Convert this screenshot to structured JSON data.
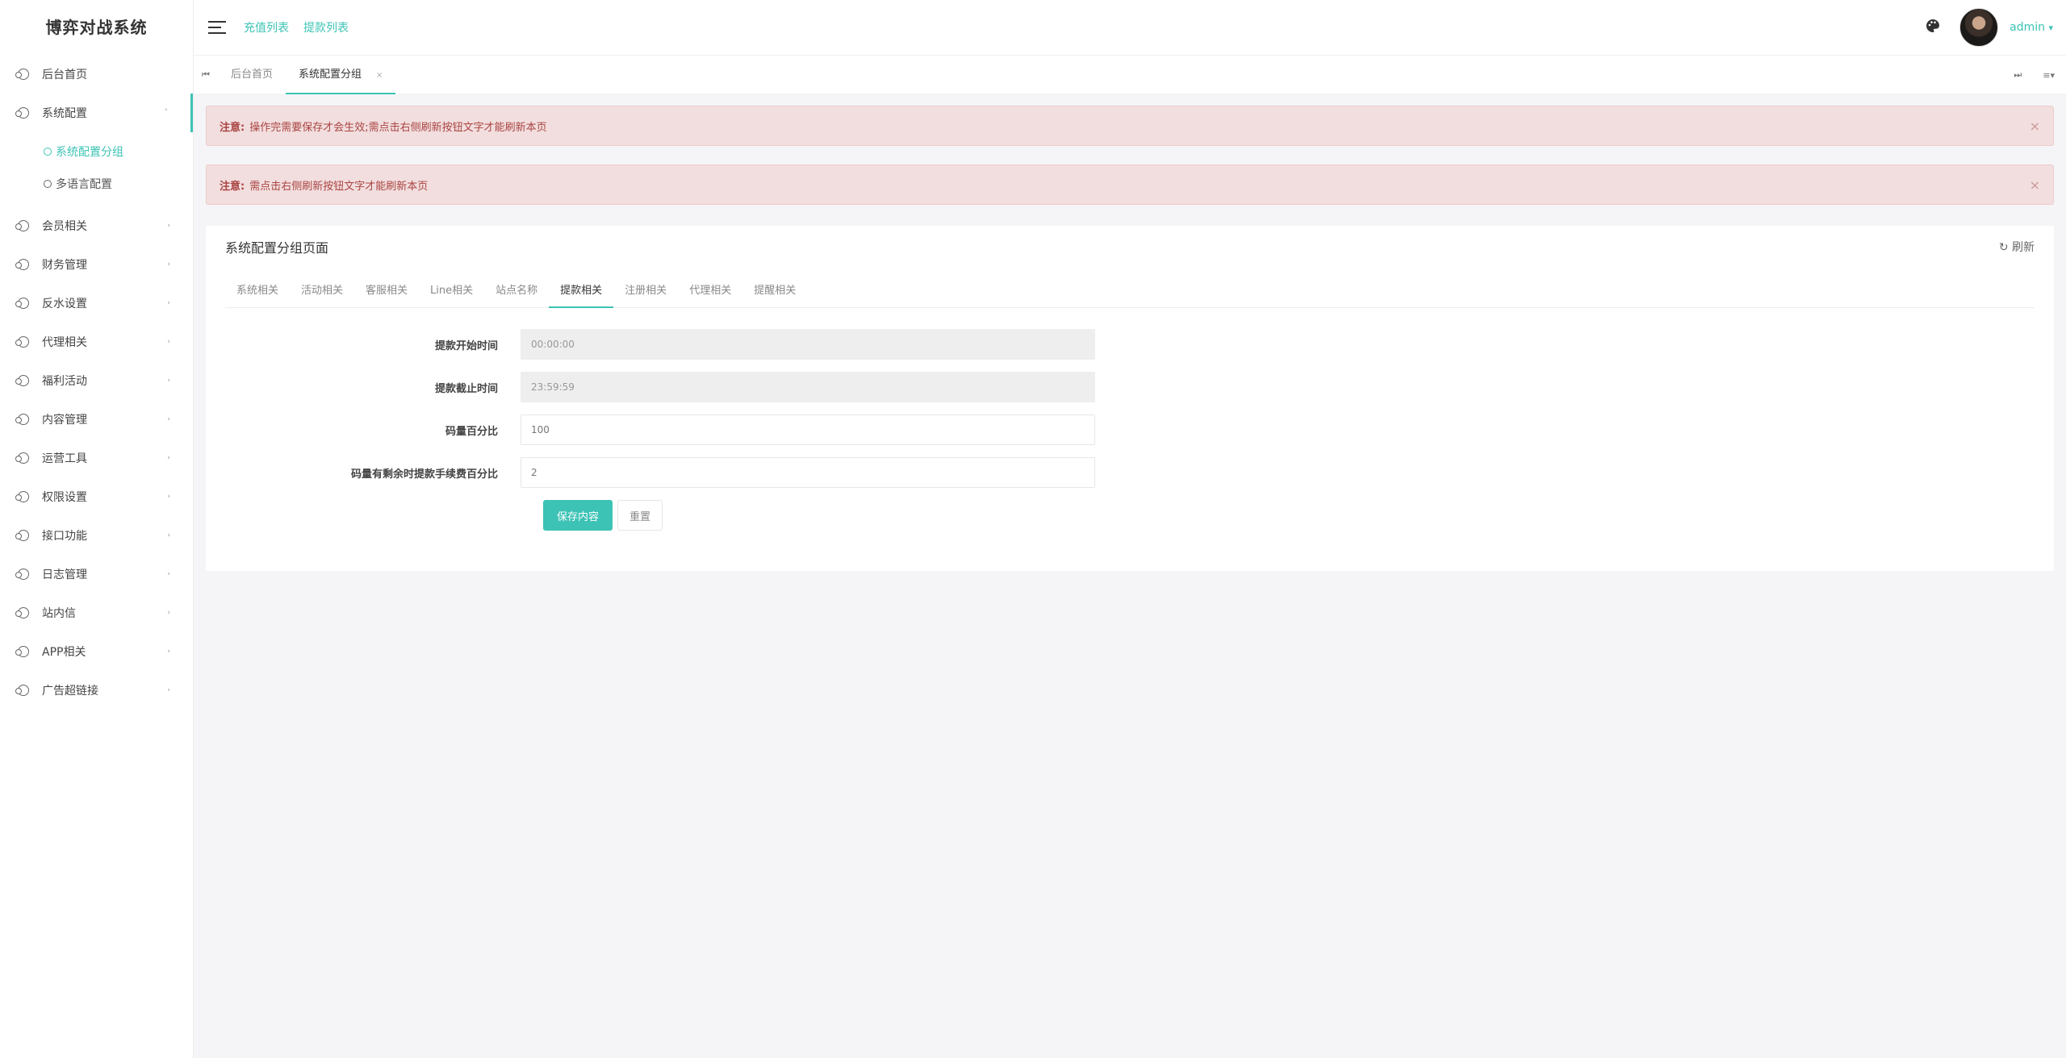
{
  "app": {
    "title": "博弈对战系统"
  },
  "sidebar": {
    "items": [
      {
        "label": "后台首页"
      },
      {
        "label": "系统配置",
        "arrow": "˅",
        "open": true
      },
      {
        "label": "会员相关",
        "arrow": "›"
      },
      {
        "label": "财务管理",
        "arrow": "›"
      },
      {
        "label": "反水设置",
        "arrow": "›"
      },
      {
        "label": "代理相关",
        "arrow": "›"
      },
      {
        "label": "福利活动",
        "arrow": "›"
      },
      {
        "label": "内容管理",
        "arrow": "›"
      },
      {
        "label": "运营工具",
        "arrow": "›"
      },
      {
        "label": "权限设置",
        "arrow": "›"
      },
      {
        "label": "接口功能",
        "arrow": "›"
      },
      {
        "label": "日志管理",
        "arrow": "›"
      },
      {
        "label": "站内信",
        "arrow": "›"
      },
      {
        "label": "APP相关",
        "arrow": "›"
      },
      {
        "label": "广告超链接",
        "arrow": "›"
      }
    ],
    "subitems": [
      {
        "label": "系统配置分组",
        "active": true
      },
      {
        "label": "多语言配置"
      }
    ]
  },
  "header": {
    "links": [
      "充值列表",
      "提款列表"
    ],
    "user": "admin",
    "user_caret": "▾"
  },
  "pagetabs": {
    "first": "⏮",
    "tabs": [
      "后台首页",
      "系统配置分组"
    ],
    "close": "×",
    "last": "⏭",
    "menu": "≡▾"
  },
  "alerts": [
    {
      "prefix": "注意:",
      "text": "操作完需要保存才会生效;需点击右侧刷新按钮文字才能刷新本页",
      "close": "×"
    },
    {
      "prefix": "注意:",
      "text": "需点击右侧刷新按钮文字才能刷新本页",
      "close": "×"
    }
  ],
  "card": {
    "title": "系统配置分组页面",
    "refresh": "刷新",
    "refresh_icon": "↻",
    "tabs": [
      "系统相关",
      "活动相关",
      "客服相关",
      "Line相关",
      "站点名称",
      "提款相关",
      "注册相关",
      "代理相关",
      "提醒相关"
    ],
    "active_tab": 5,
    "form": [
      {
        "label": "提款开始时间",
        "value": "00:00:00",
        "readonly": true
      },
      {
        "label": "提款截止时间",
        "value": "23:59:59",
        "readonly": true
      },
      {
        "label": "码量百分比",
        "value": "100",
        "readonly": false
      },
      {
        "label": "码量有剩余时提款手续费百分比",
        "value": "2",
        "readonly": false
      }
    ],
    "save": "保存内容",
    "reset": "重置"
  },
  "colors": {
    "accent": "#3cc3b5",
    "alert_bg": "#f2dede",
    "alert_text": "#a94442"
  }
}
